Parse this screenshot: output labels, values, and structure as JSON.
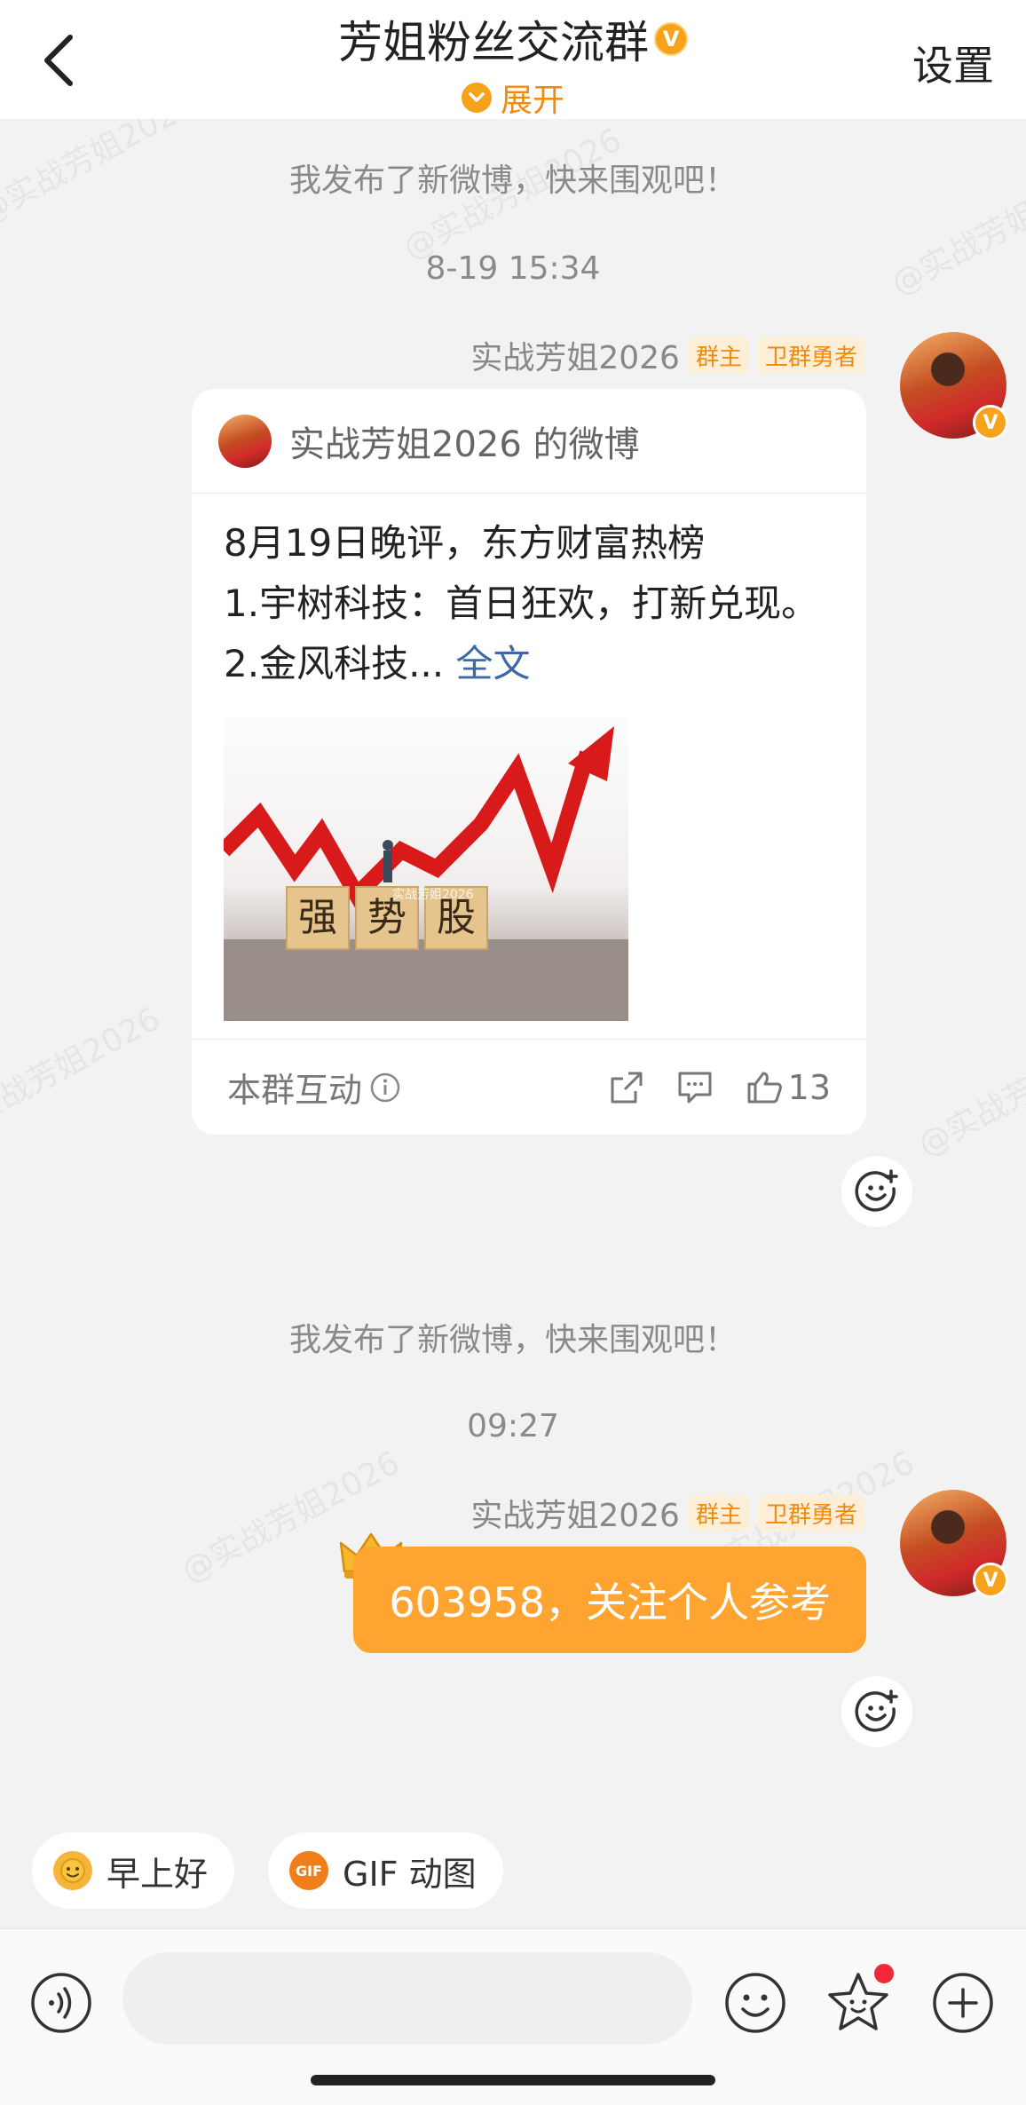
{
  "header": {
    "title": "芳姐粉丝交流群",
    "expand_label": "展开",
    "settings_label": "设置"
  },
  "watermark": "@实战芳姐2026",
  "messages": {
    "sys1": "我发布了新微博，快来围观吧！",
    "time1": "8-19 15:34",
    "sender1": "实战芳姐2026",
    "tag_owner": "群主",
    "tag_hero": "卫群勇者",
    "card": {
      "head": "实战芳姐2026 的微博",
      "line1": "8月19日晚评，东方财富热榜",
      "line2": "1.宇树科技：首日狂欢，打新兑现。",
      "line3": "2.金风科技...",
      "more_link": "全文",
      "image_blocks": [
        "强",
        "势",
        "股"
      ],
      "image_watermark": "实战芳姐2026",
      "footer_label": "本群互动",
      "like_count": "13"
    },
    "sys2": "我发布了新微博，快来围观吧！",
    "time2": "09:27",
    "sender2": "实战芳姐2026",
    "bubble_text": "603958，关注个人参考"
  },
  "quick_replies": [
    {
      "label": "早上好",
      "icon": "sun-emoji-icon"
    },
    {
      "label": "GIF 动图",
      "icon": "gif-icon"
    }
  ],
  "gif_icon_text": "GIF",
  "input": {
    "placeholder": ""
  },
  "colors": {
    "accent": "#f7a21b",
    "bubble": "#ffa430",
    "link": "#3d6aa5",
    "notify": "#f2283a"
  }
}
